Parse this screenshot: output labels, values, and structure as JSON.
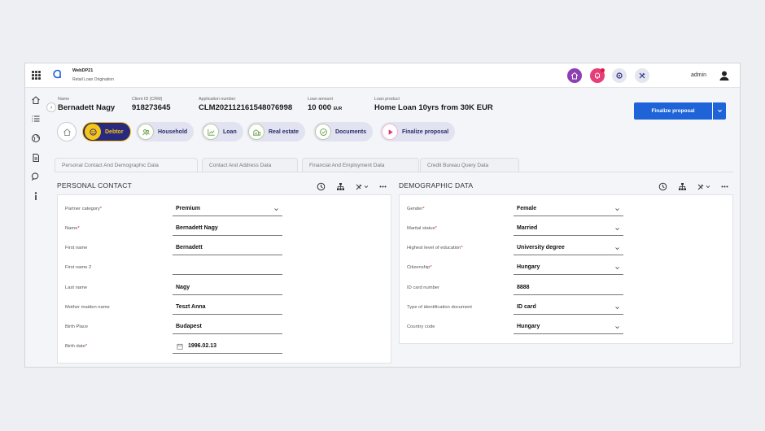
{
  "app": {
    "name": "WebDP21",
    "subtitle": "Retail Loan Origination",
    "user": "admin"
  },
  "header": {
    "name_label": "Name",
    "name_value": "Bernadett Nagy",
    "client_label": "Client ID (CRM)",
    "client_value": "918273645",
    "application_label": "Application number",
    "application_value": "CLM202112161548076998",
    "amount_label": "Loan amount",
    "amount_value": "10 000",
    "amount_currency": "EUR",
    "product_label": "Loan product",
    "product_value": "Home Loan 10yrs from 30K EUR",
    "finalize_button": "Finalize proposal"
  },
  "steps": [
    {
      "label": "Debtor",
      "icon": "face-icon",
      "active": true
    },
    {
      "label": "Household",
      "icon": "people-icon"
    },
    {
      "label": "Loan",
      "icon": "chart-icon"
    },
    {
      "label": "Real estate",
      "icon": "building-icon"
    },
    {
      "label": "Documents",
      "icon": "check-icon"
    },
    {
      "label": "Finalize proposal",
      "icon": "play-icon"
    }
  ],
  "tabs": [
    "Personal Contact And Demographic Data",
    "Contact And Address Data",
    "Financial And Employment Data",
    "Credit Bureau Query Data"
  ],
  "personal_contact": {
    "title": "PERSONAL CONTACT",
    "fields": [
      {
        "label": "Partner category",
        "required": "*",
        "value": "Premium"
      },
      {
        "label": "Name",
        "required": "*",
        "value": "Bernadett Nagy"
      },
      {
        "label": "First name",
        "required": "",
        "value": "Bernadett"
      },
      {
        "label": "First name 2",
        "required": "",
        "value": ""
      },
      {
        "label": "Last name",
        "required": "",
        "value": "Nagy"
      },
      {
        "label": "Mother maiden name",
        "required": "",
        "value": "Teszt Anna"
      },
      {
        "label": "Birth Place",
        "required": "",
        "value": "Budapest"
      },
      {
        "label": "Birth date",
        "required": "*",
        "value": "1996.02.13"
      }
    ]
  },
  "demographic": {
    "title": "DEMOGRAPHIC DATA",
    "fields": [
      {
        "label": "Gender",
        "required": "*",
        "value": "Female"
      },
      {
        "label": "Marital status",
        "required": "*",
        "value": "Married"
      },
      {
        "label": "Highest level of education",
        "required": "*",
        "value": "University degree"
      },
      {
        "label": "Citizenship",
        "required": "*",
        "value": "Hungary"
      },
      {
        "label": "ID card number",
        "required": "",
        "value": "8888"
      },
      {
        "label": "Type of identification document",
        "required": "",
        "value": "ID card"
      },
      {
        "label": "Country code",
        "required": "",
        "value": "Hungary"
      }
    ]
  },
  "colors": {
    "accent": "#1f63d8",
    "active_step": "#2a2980",
    "active_text": "#f5c518",
    "required": "#d61f3b"
  }
}
